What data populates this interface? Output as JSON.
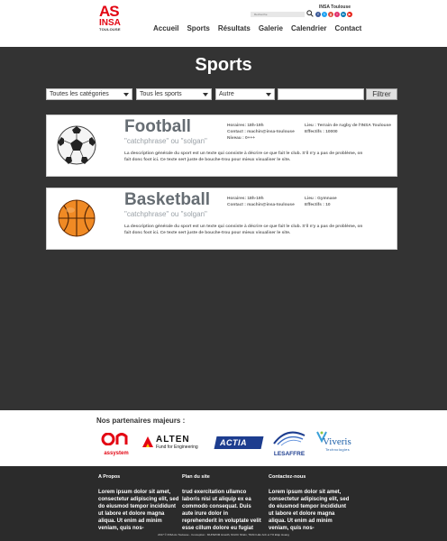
{
  "header": {
    "logo": {
      "line1": "AS",
      "line2": "INSA",
      "line3": "TOULOUSE"
    },
    "search_placeholder": "Recherche",
    "brand_name": "INSA Toulouse",
    "socials": [
      {
        "icon": "facebook-icon",
        "glyph": "f",
        "color": "#3b5998"
      },
      {
        "icon": "twitter-icon",
        "glyph": "t",
        "color": "#1da1f2"
      },
      {
        "icon": "google-plus-icon",
        "glyph": "g",
        "color": "#dd4b39"
      },
      {
        "icon": "instagram-icon",
        "glyph": "i",
        "color": "#e1306c"
      },
      {
        "icon": "linkedin-icon",
        "glyph": "in",
        "color": "#0077b5"
      },
      {
        "icon": "youtube-icon",
        "glyph": "▶",
        "color": "#e62117"
      }
    ],
    "nav": [
      "Accueil",
      "Sports",
      "Résultats",
      "Galerie",
      "Calendrier",
      "Contact"
    ]
  },
  "page": {
    "title": "Sports"
  },
  "filters": {
    "categories": "Toutes les catégories",
    "sports": "Tous les sports",
    "other": "Autre",
    "search_value": "",
    "button": "Filtrer"
  },
  "sports": [
    {
      "image": "soccer-ball-icon",
      "name": "Football",
      "catchphrase": "\"catchphrase\" ou \"solgan\"",
      "horaires": "Horaires: 18h-19h",
      "contact": "Contact : machin@insa-toulouse",
      "niveau": "Niveau : 0+++",
      "lieu": "Lieu : Terrain de rugby de l'INSA Toulouse",
      "effectifs": "Effectifs : 10000",
      "description": "La description générale du sport est un texte qui consiste à décrire ce que fait le club. S'il n'y a pas de problème, on fait donc foot ici. Ce texte sert juste de bouche-trou pour mieux visualiser le site."
    },
    {
      "image": "basketball-icon",
      "name": "Basketball",
      "catchphrase": "\"catchphrase\" ou \"solgan\"",
      "horaires": "Horaires: 18h-19h",
      "contact": "Contact : machin@insa-toulouse",
      "niveau": "",
      "lieu": "Lieu : Gymnase",
      "effectifs": "Effectifs : 10",
      "description": "La description générale du sport est un texte qui consiste à décrire ce que fait le club. S'il n'y a pas de problème, on fait donc foot ici. Ce texte sert juste de bouche-trou pour mieux visualiser le site."
    }
  ],
  "partners": {
    "title": "Nos partenaires majeurs :",
    "logos": [
      {
        "name": "On assystem",
        "text_main": "assystem"
      },
      {
        "name": "Alten",
        "text_main": "ALTEN",
        "text_sub": "Fund for Engineering"
      },
      {
        "name": "Actia",
        "text_main": "ACTIA"
      },
      {
        "name": "Lesaffre",
        "text_main": "LESAFFRE"
      },
      {
        "name": "Viveris",
        "text_main": "Viveris",
        "text_sub": "Technologies"
      }
    ]
  },
  "footer": {
    "columns": [
      {
        "title": "A Propos",
        "text": "Lorem ipsum dolor sit amet, consectetur adipiscing elit, sed do eiusmod tempor incididunt ut labore et dolore magna aliqua. Ut enim ad minim veniam, quis nos-"
      },
      {
        "title": "Plan du site",
        "text": "trud exercitation ullamco laboris nisi ut aliquip ex ea commodo consequat. Duis aute irure dolor in reprehenderit in voluptate velit esse cillum dolore eu fugiat"
      },
      {
        "title": "Contactez-nous",
        "text": "Lorem ipsum dolor sit amet, consectetur adipiscing elit, sed do eiusmod tempor incididunt ut labore et dolore magna aliqua. Ut enim ad minim veniam, quis nos-"
      }
    ],
    "copyright": "2017 © INSA As Toulouse - Conception : MUNWOM Hnwdh, NGOC Nhiên, TRAN Hân Anh et TO Điệp Hoang"
  }
}
